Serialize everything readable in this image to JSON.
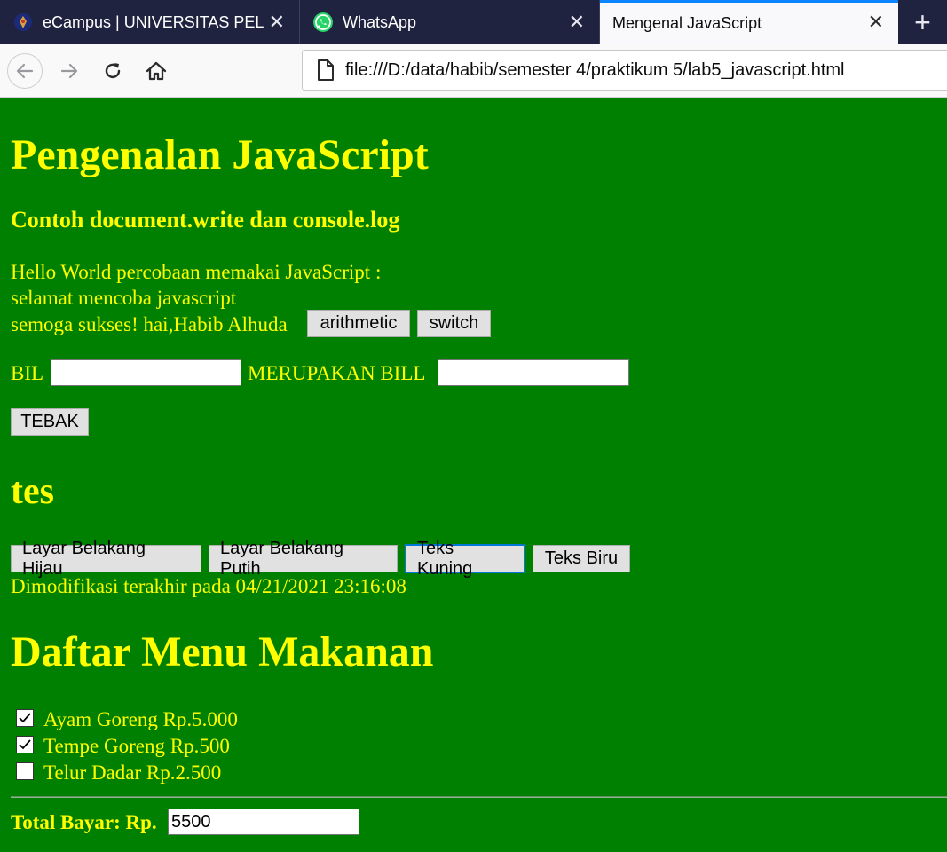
{
  "browser": {
    "tabs": [
      {
        "label": "eCampus | UNIVERSITAS PELITA",
        "icon": "university-logo-icon",
        "active": false
      },
      {
        "label": "WhatsApp",
        "icon": "whatsapp-icon",
        "active": false
      },
      {
        "label": "Mengenal JavaScript",
        "icon": "",
        "active": true
      }
    ],
    "url": "file:///D:/data/habib/semester 4/praktikum 5/lab5_javascript.html"
  },
  "page": {
    "background": "#008000",
    "text_color": "#ffff00",
    "title": "Pengenalan JavaScript",
    "subtitle": "Contoh document.write dan console.log",
    "line1": "Hello World percobaan memakai JavaScript :",
    "line2": "selamat mencoba javascript",
    "line3": "semoga sukses! hai,Habib Alhuda",
    "btn_arithmetic": "arithmetic",
    "btn_switch": "switch",
    "label_bil": "BIL",
    "bil_value": "",
    "label_merupakan": "MERUPAKAN BILL",
    "merupakan_value": "",
    "btn_tebak": "TEBAK",
    "heading_tes": "tes",
    "btn_bg_green": "Layar Belakang Hijau",
    "btn_bg_white": "Layar Belakang Putih",
    "btn_text_yellow": "Teks Kuning",
    "btn_text_blue": "Teks Biru",
    "modified": "Dimodifikasi terakhir pada 04/21/2021 23:16:08",
    "menu_title": "Daftar Menu Makanan",
    "menu_items": [
      {
        "label": "Ayam Goreng Rp.5.000",
        "checked": true
      },
      {
        "label": "Tempe Goreng Rp.500",
        "checked": true
      },
      {
        "label": "Telur Dadar Rp.2.500",
        "checked": false
      }
    ],
    "total_label": "Total Bayar: Rp.",
    "total_value": "5500"
  }
}
